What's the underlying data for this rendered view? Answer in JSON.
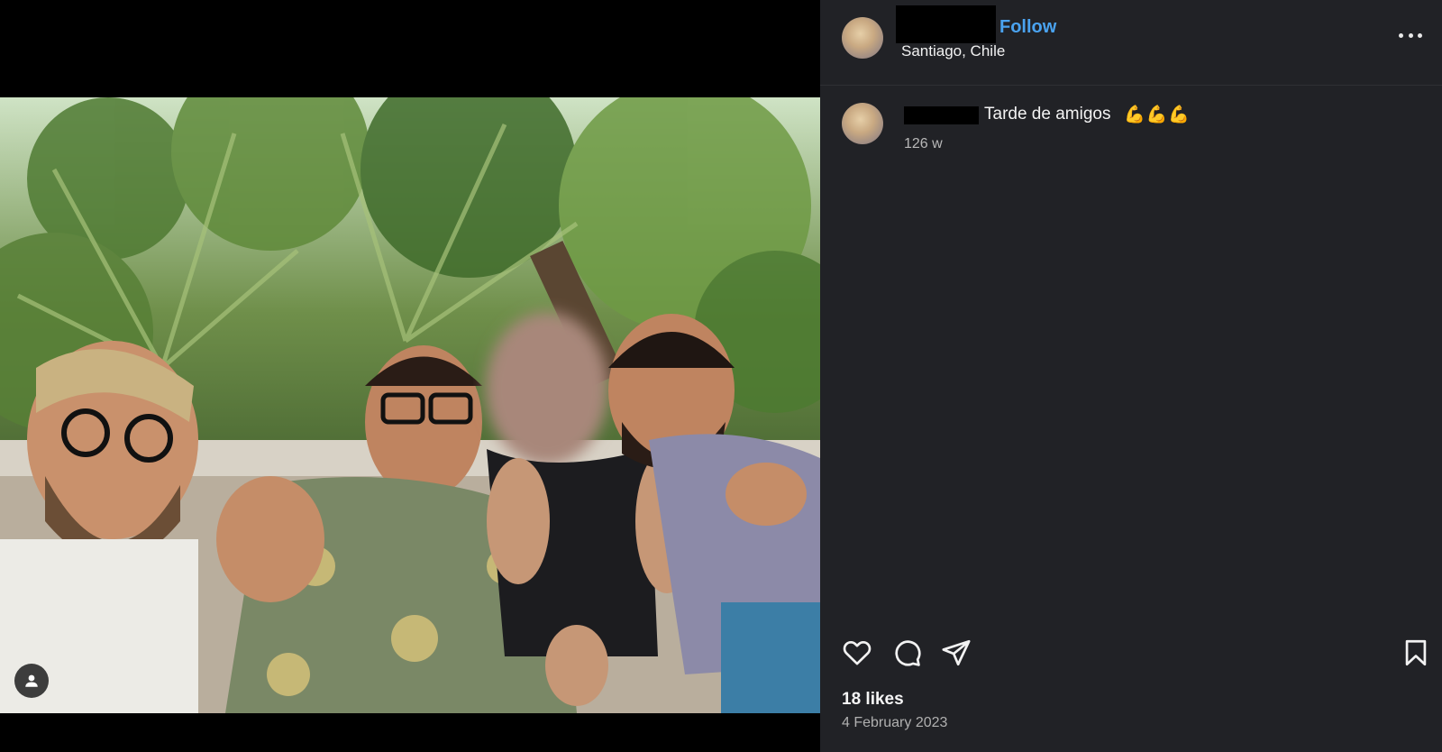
{
  "post": {
    "author_avatar_icon": "avatar-icon",
    "follow_label": "Follow",
    "location": "Santiago, Chile",
    "more_icon": "more-options-icon",
    "caption": "Tarde de amigos",
    "caption_emoji": "💪💪💪",
    "time_ago": "126 w",
    "likes": "18 likes",
    "date": "4 February 2023"
  },
  "media": {
    "tag_icon": "user-tag-icon"
  },
  "actions": {
    "like_icon": "heart-icon",
    "comment_icon": "comment-icon",
    "share_icon": "send-icon",
    "save_icon": "bookmark-icon"
  },
  "colors": {
    "panel_bg": "#212226",
    "accent": "#4aa3f0"
  }
}
